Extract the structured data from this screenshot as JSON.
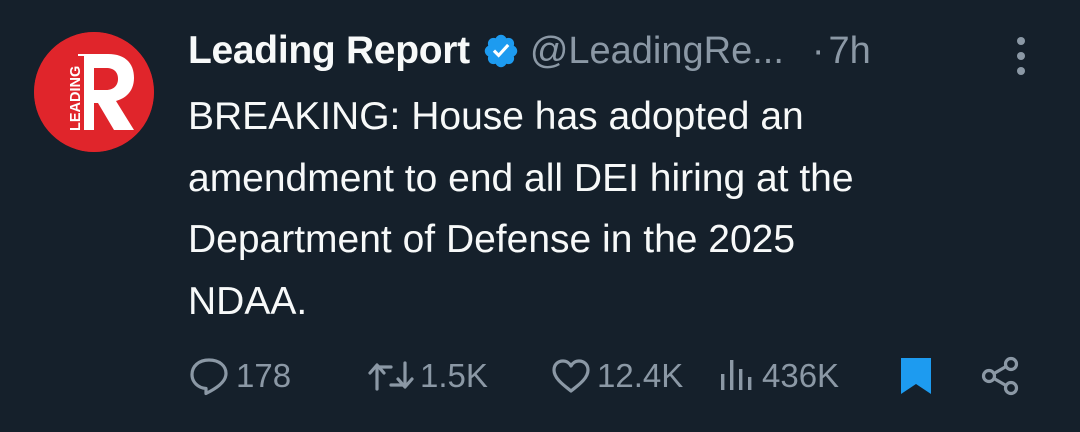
{
  "account": {
    "avatar_text": "LEADING",
    "display_name": "Leading Report",
    "handle": "@LeadingRe...",
    "separator": "·",
    "time": "7h"
  },
  "tweet": {
    "line1": "BREAKING: House has adopted an",
    "line2": "amendment to end all DEI hiring at the",
    "line3": "Department of Defense in the 2025",
    "line4": "NDAA."
  },
  "stats": {
    "replies": "178",
    "retweets": "1.5K",
    "likes": "12.4K",
    "views": "436K"
  },
  "icons": {
    "verified": "verified-badge-icon",
    "more": "more-vertical-icon",
    "reply": "reply-icon",
    "retweet": "retweet-icon",
    "like": "heart-icon",
    "views": "views-icon",
    "bookmark": "bookmark-icon",
    "share": "share-icon"
  },
  "colors": {
    "background": "#15202b",
    "text": "#f7f9f9",
    "muted": "#8b98a5",
    "accent": "#1d9bf0",
    "avatar": "#e0252b"
  }
}
